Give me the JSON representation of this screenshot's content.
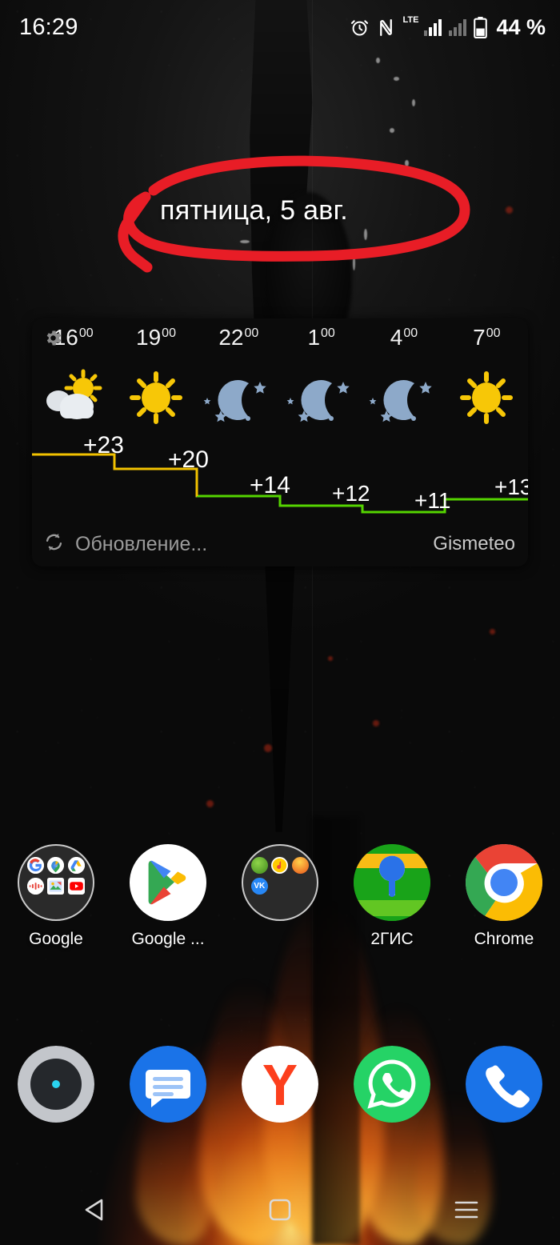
{
  "status_bar": {
    "clock": "16:29",
    "battery_percent": "44 %",
    "network_type": "LTE",
    "icons": [
      "alarm-icon",
      "nfc-icon",
      "lte-label",
      "signal-sim1-icon",
      "signal-sim2-icon",
      "battery-icon"
    ]
  },
  "annotation": {
    "shape": "red-ellipse-handdrawn",
    "color": "#e81d26",
    "target": "date-text"
  },
  "home": {
    "date_text": "пятница, 5 авг."
  },
  "weather_widget": {
    "provider": "Gismeteo",
    "update_status": "Обновление...",
    "settings_icon": "gear-icon",
    "refresh_icon": "refresh-icon",
    "chart_data": {
      "type": "line",
      "title": "",
      "xlabel": "",
      "ylabel": "",
      "categories": [
        "16",
        "19",
        "22",
        "1",
        "4",
        "7"
      ],
      "hour_minutes": [
        "00",
        "00",
        "00",
        "00",
        "00",
        "00"
      ],
      "values": [
        23,
        20,
        14,
        12,
        11,
        13
      ],
      "value_labels": [
        "+23",
        "+20",
        "+14",
        "+12",
        "+11",
        "+13"
      ],
      "conditions": [
        "partly-cloudy-day",
        "sunny",
        "clear-night",
        "clear-night",
        "clear-night",
        "sunny"
      ],
      "segment_colors": [
        "#f2c200",
        "#f2c200",
        "#7ddc1f",
        "#55d400",
        "#55d400",
        "#55d400"
      ],
      "ylim": [
        10,
        24
      ],
      "grid": false,
      "legend": "none",
      "style": "step"
    }
  },
  "app_grid": [
    {
      "label": "Google",
      "type": "folder",
      "name": "folder-google",
      "mini_icons": [
        "google-g-icon",
        "google-maps-icon",
        "google-drive-icon",
        "google-podcasts-icon",
        "google-photos-icon",
        "youtube-icon"
      ]
    },
    {
      "label": "Google ...",
      "type": "app",
      "name": "app-google-play",
      "icon": "google-play-icon"
    },
    {
      "label": "",
      "type": "folder",
      "name": "folder-social",
      "mini_icons": [
        "app-green-icon",
        "app-music-icon",
        "app-orange-icon",
        "vk-icon"
      ]
    },
    {
      "label": "2ГИС",
      "type": "app",
      "name": "app-2gis",
      "icon": "2gis-icon"
    },
    {
      "label": "Chrome",
      "type": "app",
      "name": "app-chrome",
      "icon": "chrome-icon"
    }
  ],
  "dock": [
    {
      "name": "dock-camera",
      "icon": "camera-icon"
    },
    {
      "name": "dock-messages",
      "icon": "messages-icon"
    },
    {
      "name": "dock-yandex",
      "icon": "yandex-browser-icon"
    },
    {
      "name": "dock-whatsapp",
      "icon": "whatsapp-icon"
    },
    {
      "name": "dock-phone",
      "icon": "phone-icon"
    }
  ],
  "nav_bar": [
    {
      "name": "nav-back",
      "icon": "back-triangle-icon"
    },
    {
      "name": "nav-home",
      "icon": "home-square-icon"
    },
    {
      "name": "nav-recents",
      "icon": "recents-menu-icon"
    }
  ],
  "colors": {
    "accent_red": "#e81d26",
    "warm_line": "#f2c200",
    "cool_line": "#55d400",
    "widget_bg": "#0b0b0b",
    "text_primary": "#ffffff",
    "text_muted": "#9b9b9b"
  }
}
